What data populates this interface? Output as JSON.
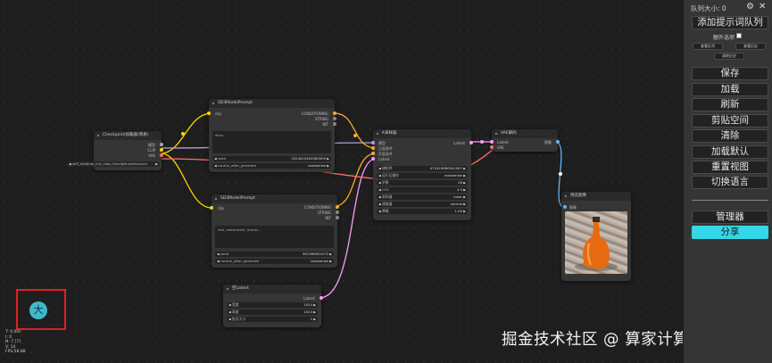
{
  "sidebar": {
    "queue_size": "队列大小: 0",
    "add_to_queue": "添加提示词队列",
    "extra_options": "额外选项",
    "view_queue": "查看队列",
    "view_history": "查看历史",
    "small3": "清除历史",
    "buttons": [
      "保存",
      "加载",
      "刷新",
      "剪贴空间",
      "清除",
      "加载默认",
      "重置视图",
      "切换语言"
    ],
    "manager": "管理器",
    "share": "分享"
  },
  "nodes": {
    "checkpoint": {
      "title": "Checkpoint加载器(简易)",
      "out_model": "模型",
      "out_clip": "CLIP",
      "out_vae": "VAE",
      "ckpt_name": "sd3_medium_incl_clips_t5xxlfp8.safetensors"
    },
    "pos_prompt": {
      "title": "SD3ModelPrompt",
      "in_clip": "clip",
      "out_cond": "CONDITIONING",
      "out_string": "STRING",
      "out_int": "INT",
      "text": "alien.",
      "seed_label": "seed",
      "seed_value": "2024010404560000",
      "ctrl_label": "control_after_generate",
      "ctrl_value": "randomize"
    },
    "neg_prompt": {
      "title": "SD3ModelPrompt",
      "in_clip": "clip",
      "out_cond": "CONDITIONING",
      "out_string": "STRING",
      "out_int": "INT",
      "text": "text, watermark, lowres...",
      "seed_label": "seed",
      "seed_value": "981380834172",
      "ctrl_label": "control_after_generate",
      "ctrl_value": "randomize"
    },
    "ksampler": {
      "title": "K采样器",
      "in_model": "模型",
      "in_pos": "正面条件",
      "in_neg": "负面条件",
      "in_latent": "Latent",
      "out_latent": "Latent",
      "widgets": [
        {
          "label": "随机种",
          "value": "472418980941907"
        },
        {
          "label": "运行后操作",
          "value": "randomize"
        },
        {
          "label": "步数",
          "value": "28"
        },
        {
          "label": "CFG",
          "value": "4.5"
        },
        {
          "label": "采样器",
          "value": "euler"
        },
        {
          "label": "调度器",
          "value": "normal"
        },
        {
          "label": "降噪",
          "value": "1.00"
        }
      ]
    },
    "vae_decode": {
      "title": "VAE解码",
      "in_latent": "Latent",
      "in_vae": "VAE",
      "out_image": "图像"
    },
    "preview": {
      "title": "预览图像",
      "in_images": "图像"
    },
    "empty_latent": {
      "title": "空Latent",
      "out_latent": "Latent",
      "widgets": [
        {
          "label": "宽度",
          "value": "1024"
        },
        {
          "label": "高度",
          "value": "1024"
        },
        {
          "label": "批次大小",
          "value": "1"
        }
      ]
    }
  },
  "stats": [
    "T: 0.00s",
    "I: 0",
    "N: 7 [7]",
    "V: 14",
    "FPS:58.88"
  ],
  "avatar_char": "大",
  "watermark": "掘金技术社区 @ 算家计算",
  "colors": {
    "clip": "#ffd500",
    "conditioning": "#ffa931",
    "latent": "#ff9cf9",
    "vae": "#ff6e6e",
    "model": "#b39ddb",
    "image": "#64b5f6",
    "share": "#35d6e9"
  }
}
